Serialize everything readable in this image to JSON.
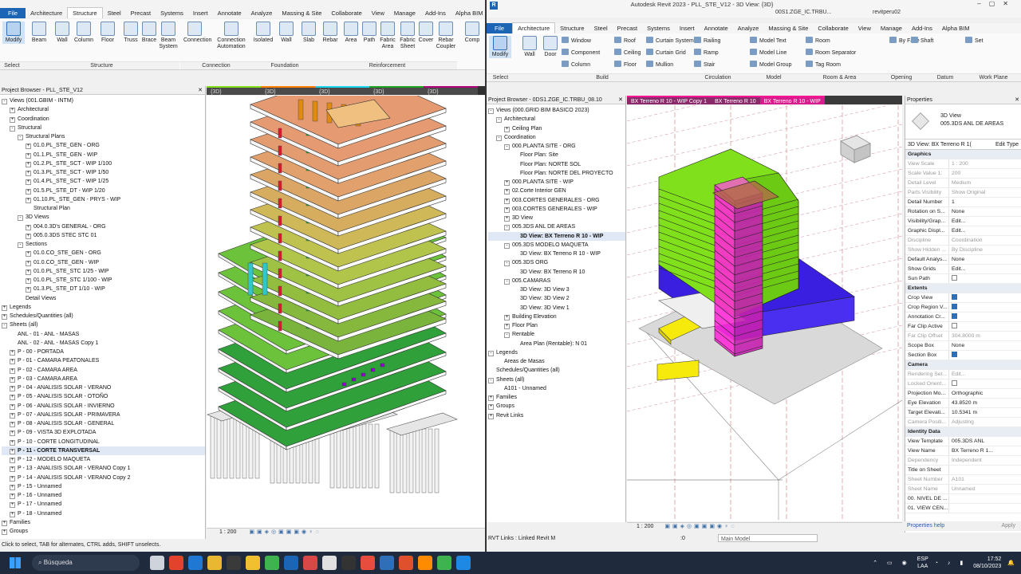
{
  "left": {
    "tabs": [
      "File",
      "Architecture",
      "Structure",
      "Steel",
      "Precast",
      "Systems",
      "Insert",
      "Annotate",
      "Analyze",
      "Massing & Site",
      "Collaborate",
      "View",
      "Manage",
      "Add-Ins",
      "Alpha BIM"
    ],
    "active_tab": "Structure",
    "ribbon_buttons": [
      "Modify",
      "Beam",
      "Wall",
      "Column",
      "Floor",
      "Truss",
      "Brace",
      "Beam System",
      "Connection",
      "Connection Automation",
      "Isolated",
      "Wall",
      "Slab",
      "Rebar",
      "Area",
      "Path",
      "Fabric Area",
      "Fabric Sheet",
      "Cover",
      "Rebar Coupler",
      "Comp"
    ],
    "panels": {
      "select": "Select",
      "structure": "Structure",
      "connection": "Connection",
      "foundation": "Foundation",
      "reinforcement": "Reinforcement"
    },
    "browser_title": "Project Browser - PLL_STE_V12",
    "tree": [
      {
        "d": 0,
        "t": "Views (001.GBIM - INTM)",
        "g": "-"
      },
      {
        "d": 1,
        "t": "Architectural",
        "g": "+"
      },
      {
        "d": 1,
        "t": "Coordination",
        "g": "+"
      },
      {
        "d": 1,
        "t": "Structural",
        "g": "-"
      },
      {
        "d": 2,
        "t": "Structural Plans",
        "g": "-"
      },
      {
        "d": 3,
        "t": "01.0.PL_STE_GEN - ORG",
        "g": "+"
      },
      {
        "d": 3,
        "t": "01.1.PL_STE_GEN - WIP",
        "g": "+"
      },
      {
        "d": 3,
        "t": "01.2.PL_STE_SCT - WIP 1/100",
        "g": "+"
      },
      {
        "d": 3,
        "t": "01.3.PL_STE_SCT - WIP 1/50",
        "g": "+"
      },
      {
        "d": 3,
        "t": "01.4.PL_STE_SCT - WIP 1/25",
        "g": "+"
      },
      {
        "d": 3,
        "t": "01.5.PL_STE_DT - WIP 1/20",
        "g": "+"
      },
      {
        "d": 3,
        "t": "01.10.PL_STE_GEN - PRYS - WIP",
        "g": "+"
      },
      {
        "d": 3,
        "t": "Structural Plan",
        "g": ""
      },
      {
        "d": 2,
        "t": "3D Views",
        "g": "-"
      },
      {
        "d": 3,
        "t": "004.0.3D's GENERAL - ORG",
        "g": "+"
      },
      {
        "d": 3,
        "t": "005.0.3DS STEC STC 01",
        "g": "+"
      },
      {
        "d": 2,
        "t": "Sections",
        "g": "-"
      },
      {
        "d": 3,
        "t": "01.0.CO_STE_GEN - ORG",
        "g": "+"
      },
      {
        "d": 3,
        "t": "01.0.CO_STE_GEN - WIP",
        "g": "+"
      },
      {
        "d": 3,
        "t": "01.0.PL_STE_STC 1/25 - WIP",
        "g": "+"
      },
      {
        "d": 3,
        "t": "01.0.PL_STE_STC 1/100 - WIP",
        "g": "+"
      },
      {
        "d": 3,
        "t": "01.3.PL_STE_DT 1/10 - WIP",
        "g": "+"
      },
      {
        "d": 2,
        "t": "Detail Views",
        "g": ""
      },
      {
        "d": 0,
        "t": "Legends",
        "g": "+"
      },
      {
        "d": 0,
        "t": "Schedules/Quantities (all)",
        "g": "+"
      },
      {
        "d": 0,
        "t": "Sheets (all)",
        "g": "-"
      },
      {
        "d": 1,
        "t": "ANL - 01 - ANL - MASAS",
        "g": ""
      },
      {
        "d": 1,
        "t": "ANL - 02 - ANL - MASAS Copy 1",
        "g": ""
      },
      {
        "d": 1,
        "t": "P - 00 - PORTADA",
        "g": "+"
      },
      {
        "d": 1,
        "t": "P - 01 - CAMARA PEATONALES",
        "g": "+"
      },
      {
        "d": 1,
        "t": "P - 02 - CAMARA AREA",
        "g": "+"
      },
      {
        "d": 1,
        "t": "P - 03 - CAMARA AREA",
        "g": "+"
      },
      {
        "d": 1,
        "t": "P - 04 - ANALISIS SOLAR - VERANO",
        "g": "+"
      },
      {
        "d": 1,
        "t": "P - 05 - ANALISIS SOLAR - OTOÑO",
        "g": "+"
      },
      {
        "d": 1,
        "t": "P - 06 - ANALISIS SOLAR - INVIERNO",
        "g": "+"
      },
      {
        "d": 1,
        "t": "P - 07 - ANALISIS SOLAR - PRIMAVERA",
        "g": "+"
      },
      {
        "d": 1,
        "t": "P - 08 - ANALISIS SOLAR - GENERAL",
        "g": "+"
      },
      {
        "d": 1,
        "t": "P - 09 - VISTA 3D EXPLOTADA",
        "g": "+"
      },
      {
        "d": 1,
        "t": "P - 10 - CORTE LONGITUDINAL",
        "g": "+"
      },
      {
        "d": 1,
        "t": "P - 11 - CORTE TRANSVERSAL",
        "g": "+",
        "sel": true
      },
      {
        "d": 1,
        "t": "P - 12 - MODELO MAQUETA",
        "g": "+"
      },
      {
        "d": 1,
        "t": "P - 13 - ANALISIS SOLAR - VERANO Copy 1",
        "g": "+"
      },
      {
        "d": 1,
        "t": "P - 14 - ANALISIS SOLAR - VERANO Copy 2",
        "g": "+"
      },
      {
        "d": 1,
        "t": "P - 15 - Unnamed",
        "g": "+"
      },
      {
        "d": 1,
        "t": "P - 16 - Unnamed",
        "g": "+"
      },
      {
        "d": 1,
        "t": "P - 17 - Unnamed",
        "g": "+"
      },
      {
        "d": 1,
        "t": "P - 18 - Unnamed",
        "g": "+"
      },
      {
        "d": 0,
        "t": "Families",
        "g": "+"
      },
      {
        "d": 0,
        "t": "Groups",
        "g": "+"
      }
    ],
    "view_tabs": [
      "{3D}",
      "{3D}",
      "{3D}",
      "{3D}",
      "{3D}"
    ],
    "scale": "1 : 200",
    "status": "Click to select, TAB for alternates, CTRL adds, SHIFT unselects."
  },
  "right": {
    "title": "Autodesk Revit 2023 - PLL_STE_V12 - 3D View: {3D}",
    "user": "revitperu02",
    "tab_in_title": "00S1.ZGE_IC.TRBU...",
    "tabs": [
      "File",
      "Architecture",
      "Structure",
      "Steel",
      "Precast",
      "Systems",
      "Insert",
      "Annotate",
      "Analyze",
      "Massing & Site",
      "Collaborate",
      "View",
      "Manage",
      "Add-Ins",
      "Alpha BIM"
    ],
    "active_tab": "Architecture",
    "ribbon_buttons": [
      "Modify",
      "Wall",
      "Door"
    ],
    "ribbon_small": [
      "Window",
      "Component",
      "Column",
      "Roof",
      "Ceiling",
      "Floor",
      "Curtain System",
      "Curtain Grid",
      "Mullion",
      "Railing",
      "Ramp",
      "Stair",
      "Model Text",
      "Model Line",
      "Model Group",
      "Room",
      "Room Separator",
      "Tag Room",
      "By Face",
      "Shaft",
      "Set"
    ],
    "panels": {
      "select": "Select",
      "build": "Build",
      "circulation": "Circulation",
      "model": "Model",
      "room": "Room & Area",
      "opening": "Opening",
      "datum": "Datum",
      "workplane": "Work Plane"
    },
    "browser_title": "Project Browser - 0DS1.ZGE_IC.TRBU_08.10",
    "tree": [
      {
        "d": 0,
        "t": "Views (000.GRID BIM BASICO 2023)",
        "g": "-"
      },
      {
        "d": 1,
        "t": "Architectural",
        "g": "-"
      },
      {
        "d": 2,
        "t": "Ceiling Plan",
        "g": "+"
      },
      {
        "d": 1,
        "t": "Coordination",
        "g": "-"
      },
      {
        "d": 2,
        "t": "000.PLANTA SITE - ORG",
        "g": "-"
      },
      {
        "d": 3,
        "t": "Floor Plan: Site",
        "g": ""
      },
      {
        "d": 3,
        "t": "Floor Plan: NORTE SOL",
        "g": ""
      },
      {
        "d": 3,
        "t": "Floor Plan: NORTE DEL PROYECTO",
        "g": ""
      },
      {
        "d": 2,
        "t": "000.PLANTA SITE - WIP",
        "g": "+"
      },
      {
        "d": 2,
        "t": "02.Corte Interior GEN",
        "g": "+"
      },
      {
        "d": 2,
        "t": "003.CORTES GENERALES - ORG",
        "g": "+"
      },
      {
        "d": 2,
        "t": "003.CORTES GENERALES - WIP",
        "g": "+"
      },
      {
        "d": 2,
        "t": "3D View",
        "g": "+"
      },
      {
        "d": 2,
        "t": "005.3DS ANL DE AREAS",
        "g": "-"
      },
      {
        "d": 3,
        "t": "3D View: BX Terreno R 10 - WIP",
        "g": "",
        "sel": true
      },
      {
        "d": 2,
        "t": "005.3DS MODELO MAQUETA",
        "g": "-"
      },
      {
        "d": 3,
        "t": "3D View: BX Terreno R 10 - WIP",
        "g": ""
      },
      {
        "d": 2,
        "t": "005.3DS ORG",
        "g": "-"
      },
      {
        "d": 3,
        "t": "3D View: BX Terreno R 10",
        "g": ""
      },
      {
        "d": 2,
        "t": "005.CAMARAS",
        "g": "-"
      },
      {
        "d": 3,
        "t": "3D View: 3D View 3",
        "g": ""
      },
      {
        "d": 3,
        "t": "3D View: 3D View 2",
        "g": ""
      },
      {
        "d": 3,
        "t": "3D View: 3D View 1",
        "g": ""
      },
      {
        "d": 2,
        "t": "Building Elevation",
        "g": "+"
      },
      {
        "d": 2,
        "t": "Floor Plan",
        "g": "+"
      },
      {
        "d": 2,
        "t": "Rentable",
        "g": "-"
      },
      {
        "d": 3,
        "t": "Area Plan (Rentable): N 01",
        "g": ""
      },
      {
        "d": 0,
        "t": "Legends",
        "g": "-"
      },
      {
        "d": 1,
        "t": "Areas de Masas",
        "g": ""
      },
      {
        "d": 0,
        "t": "Schedules/Quantities (all)",
        "g": ""
      },
      {
        "d": 0,
        "t": "Sheets (all)",
        "g": "-"
      },
      {
        "d": 1,
        "t": "A101 - Unnamed",
        "g": ""
      },
      {
        "d": 0,
        "t": "Families",
        "g": "+"
      },
      {
        "d": 0,
        "t": "Groups",
        "g": "+"
      },
      {
        "d": 0,
        "t": "Revit Links",
        "g": "+"
      }
    ],
    "view_tabs": [
      "BX Terreno R 10 - WIP Copy 1",
      "BX Terreno R 10",
      "BX Terreno R 10 - WIP"
    ],
    "props_title": "Properties",
    "type_name": "3D View",
    "type_sub": "005.3DS ANL DE AREAS",
    "instance": "3D View: BX Terreno R 1(",
    "edit_type": "Edit Type",
    "props": [
      {
        "sec": "Graphics"
      },
      {
        "k": "View Scale",
        "v": "1 : 200",
        "grey": true
      },
      {
        "k": "Scale Value  1:",
        "v": "200",
        "grey": true
      },
      {
        "k": "Detail Level",
        "v": "Medium",
        "grey": true
      },
      {
        "k": "Parts Visibility",
        "v": "Show Original",
        "grey": true
      },
      {
        "k": "Detail Number",
        "v": "1"
      },
      {
        "k": "Rotation on S...",
        "v": "None"
      },
      {
        "k": "Visibility/Grap...",
        "v": "Edit..."
      },
      {
        "k": "Graphic Displ...",
        "v": "Edit..."
      },
      {
        "k": "Discipline",
        "v": "Coordination",
        "grey": true
      },
      {
        "k": "Show Hidden ...",
        "v": "By Discipline",
        "grey": true
      },
      {
        "k": "Default Analys...",
        "v": "None"
      },
      {
        "k": "Show Grids",
        "v": "Edit..."
      },
      {
        "k": "Sun Path",
        "v": "",
        "chk": "off"
      },
      {
        "sec": "Extents"
      },
      {
        "k": "Crop View",
        "v": "",
        "chk": "on"
      },
      {
        "k": "Crop Region V...",
        "v": "",
        "chk": "on"
      },
      {
        "k": "Annotation Cr...",
        "v": "",
        "chk": "on"
      },
      {
        "k": "Far Clip Active",
        "v": "",
        "chk": "off"
      },
      {
        "k": "Far Clip Offset",
        "v": "304.8000 m",
        "grey": true
      },
      {
        "k": "Scope Box",
        "v": "None"
      },
      {
        "k": "Section Box",
        "v": "",
        "chk": "on"
      },
      {
        "sec": "Camera"
      },
      {
        "k": "Rendering Set...",
        "v": "Edit...",
        "grey": true
      },
      {
        "k": "Locked Orient...",
        "v": "",
        "chk": "off",
        "grey": true
      },
      {
        "k": "Projection Mo...",
        "v": "Orthographic"
      },
      {
        "k": "Eye Elevation",
        "v": "43.8520 m"
      },
      {
        "k": "Target Elevati...",
        "v": "10.5341 m"
      },
      {
        "k": "Camera Positi...",
        "v": "Adjusting",
        "grey": true
      },
      {
        "sec": "Identity Data"
      },
      {
        "k": "View Template",
        "v": "005.3DS ANL"
      },
      {
        "k": "View Name",
        "v": "BX Terreno R 1..."
      },
      {
        "k": "Dependency",
        "v": "Independent",
        "grey": true
      },
      {
        "k": "Title on Sheet",
        "v": ""
      },
      {
        "k": "Sheet Number",
        "v": "A101",
        "grey": true
      },
      {
        "k": "Sheet Name",
        "v": "Unnamed",
        "grey": true
      },
      {
        "k": "00. NIVEL DE ...",
        "v": ""
      },
      {
        "k": "01. VIEW CEN...",
        "v": ""
      }
    ],
    "props_help": "Properties help",
    "apply": "Apply",
    "scale": "1 : 200",
    "status": "RVT Links : Linked Revit M",
    "model": "Main Model",
    "zero": ":0"
  },
  "taskbar": {
    "search": "Búsqueda",
    "lang1": "ESP",
    "lang2": "LAA",
    "time": "17:52",
    "date": "08/10/2023"
  },
  "colors": {
    "accent": "#1b65b4",
    "green": "#7fe01b",
    "magenta": "#ff2bd6",
    "blue": "#3b1fe0",
    "yellow": "#f6ea0c"
  }
}
